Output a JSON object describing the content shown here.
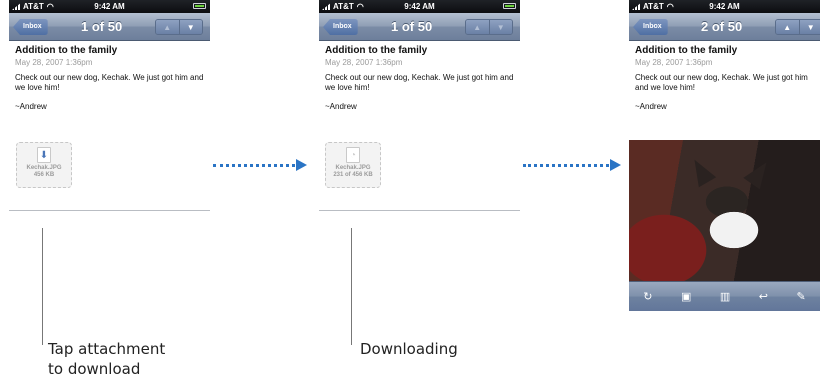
{
  "screens": [
    {
      "status": {
        "carrier": "AT&T",
        "time": "9:42 AM"
      },
      "nav": {
        "back_label": "Inbox",
        "counter": "1 of 50"
      },
      "mail": {
        "subject": "Addition to the family",
        "date": "May 28, 2007 1:36pm",
        "body": "Check out our new dog, Kechak. We just got him and we love him!",
        "signature": "~Andrew"
      },
      "attachment": {
        "name": "Kechak.JPG",
        "size": "456 KB",
        "icon": "download-arrow-icon"
      }
    },
    {
      "status": {
        "carrier": "AT&T",
        "time": "9:42 AM"
      },
      "nav": {
        "back_label": "Inbox",
        "counter": "1 of 50"
      },
      "mail": {
        "subject": "Addition to the family",
        "date": "May 28, 2007 1:36pm",
        "body": "Check out our new dog, Kechak. We just got him and we love him!",
        "signature": "~Andrew"
      },
      "attachment": {
        "name": "Kechak.JPG",
        "size": "231 of 456 KB",
        "icon": "loading-file-icon"
      }
    },
    {
      "status": {
        "carrier": "AT&T",
        "time": "9:42 AM"
      },
      "nav": {
        "back_label": "Inbox",
        "counter": "2 of 50"
      },
      "mail": {
        "subject": "Addition to the family",
        "date": "May 28, 2007 1:36pm",
        "body": "Check out our new dog, Kechak. We just got him and we love him!",
        "signature": "~Andrew"
      },
      "toolbar": [
        "refresh-icon",
        "move-to-folder-icon",
        "trash-icon",
        "reply-icon",
        "compose-icon"
      ]
    }
  ],
  "captions": {
    "tap": "Tap attachment\nto download",
    "downloading": "Downloading"
  },
  "colors": {
    "connector": "#2a74c5",
    "nav_bar": "#8e9db4"
  }
}
